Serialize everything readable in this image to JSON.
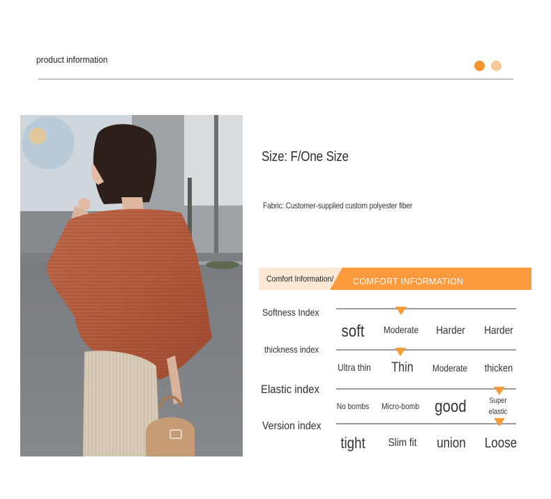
{
  "header": {
    "title": "product information"
  },
  "colors": {
    "accent": "#f7942f",
    "accent_light": "#f9c99a",
    "banner_light": "#fde8d6"
  },
  "size": "Size: F/One Size",
  "fabric": "Fabric: Customer-supplied custom polyester fiber",
  "banner": {
    "left": "Comfort Information/",
    "right": "COMFORT INFORMATION"
  },
  "rows": [
    {
      "label": "Softness Index",
      "options": [
        "soft",
        "Moderate",
        "Harder",
        "Harder"
      ],
      "selected": "Moderate"
    },
    {
      "label": "thickness index",
      "options": [
        "Ultra thin",
        "Thin",
        "Moderate",
        "thicken"
      ],
      "selected": "Thin"
    },
    {
      "label": "Elastic index",
      "options": [
        "No bombs",
        "Micro-bomb",
        "good",
        "Super elastic"
      ],
      "selected": "Super elastic"
    },
    {
      "label": "Version index",
      "options": [
        "tight",
        "Slim fit",
        "union",
        "Loose"
      ],
      "selected": "Loose"
    }
  ]
}
